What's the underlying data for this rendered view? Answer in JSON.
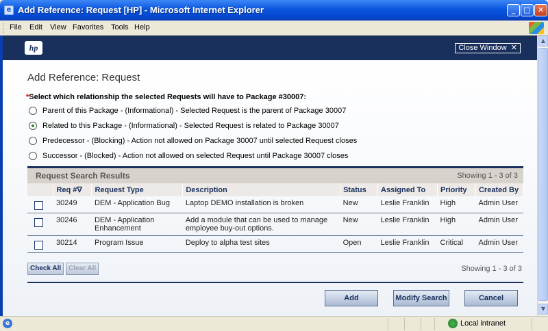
{
  "window": {
    "title": "Add Reference: Request [HP] - Microsoft Internet Explorer",
    "buttons": [
      "minimize",
      "maximize",
      "close"
    ]
  },
  "menu": [
    "File",
    "Edit",
    "View",
    "Favorites",
    "Tools",
    "Help"
  ],
  "header": {
    "logo": "hp",
    "close_window": "Close Window"
  },
  "page": {
    "heading": "Add Reference: Request",
    "required_mark": "*",
    "question": "Select which relationship the selected Requests will have to Package #30007:",
    "options": [
      {
        "label": "Parent of this Package - (Informational) - Selected Request is the parent of Package 30007",
        "selected": false
      },
      {
        "label": "Related to this Package - (Informational) - Selected Request is related to Package 30007",
        "selected": true
      },
      {
        "label": "Predecessor - (Blocking) - Action not allowed on Package 30007 until selected Request closes",
        "selected": false
      },
      {
        "label": "Successor - (Blocked) - Action not allowed on selected Request until Package 30007 closes",
        "selected": false
      }
    ]
  },
  "results": {
    "title": "Request Search Results",
    "showing": "Showing 1 - 3 of 3",
    "columns": [
      "Req #∇",
      "Request Type",
      "Description",
      "Status",
      "Assigned To",
      "Priority",
      "Created By"
    ],
    "rows": [
      [
        "30249",
        "DEM - Application Bug",
        "Laptop DEMO installation is broken",
        "New",
        "Leslie Franklin",
        "High",
        "Admin User"
      ],
      [
        "30246",
        "DEM - Application Enhancement",
        "Add a module that can be used to manage employee buy-out options.",
        "New",
        "Leslie Franklin",
        "High",
        "Admin User"
      ],
      [
        "30214",
        "Program Issue",
        "Deploy to alpha test sites",
        "Open",
        "Leslie Franklin",
        "Critical",
        "Admin User"
      ]
    ],
    "check_all": "Check All",
    "clear_all": "Clear All",
    "showing_bottom": "Showing 1 - 3 of 3"
  },
  "actions": {
    "add": "Add",
    "modify_search": "Modify Search",
    "cancel": "Cancel"
  },
  "status": {
    "zone": "Local intranet"
  }
}
